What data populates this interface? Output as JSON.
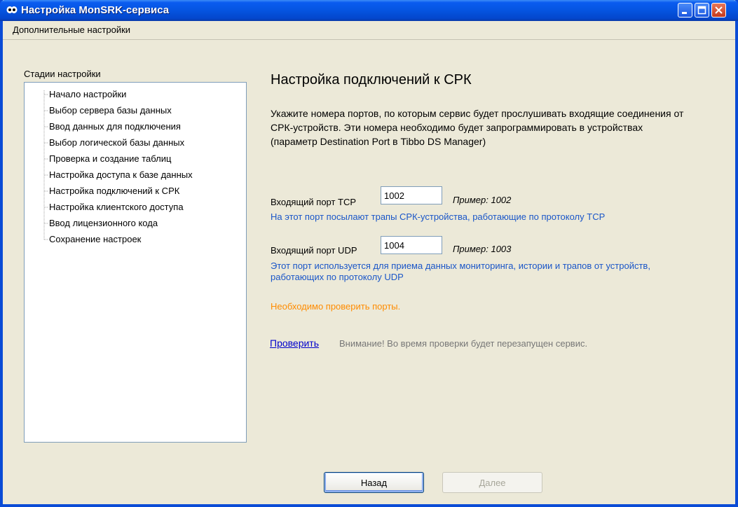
{
  "window": {
    "title": "Настройка MonSRK-сервиса",
    "icon": "app-logo-icon"
  },
  "menubar": {
    "items": [
      "Дополнительные настройки"
    ]
  },
  "sidebar": {
    "label": "Стадии настройки",
    "items": [
      "Начало настройки",
      "Выбор сервера базы данных",
      "Ввод данных для подключения",
      "Выбор логической базы данных",
      "Проверка и создание таблиц",
      "Настройка доступа к базе данных",
      "Настройка подключений к СРК",
      "Настройка клиентского доступа",
      "Ввод лицензионного кода",
      "Сохранение настроек"
    ]
  },
  "main": {
    "heading": "Настройка подключений к СРК",
    "description": "Укажите номера портов, по которым сервис будет прослушивать входящие соединения от СРК-устройств. Эти номера необходимо будет запрограммировать в устройствах (параметр Destination Port в Tibbo DS Manager)",
    "tcp": {
      "label": "Входящий порт TCP",
      "value": "1002",
      "example": "Пример: 1002",
      "hint": "На этот порт посылают трапы СРК-устройства, работающие по протоколу TCP"
    },
    "udp": {
      "label": "Входящий порт UDP",
      "value": "1004",
      "example": "Пример: 1003",
      "hint": "Этот порт используется для приема данных мониторинга, истории и трапов от устройств, работающих по протоколу UDP"
    },
    "warning": "Необходимо проверить порты.",
    "check_link": "Проверить",
    "notice": "Внимание! Во время проверки будет перезапущен сервис."
  },
  "buttons": {
    "back": "Назад",
    "next": "Далее"
  },
  "colors": {
    "title_bar": "#0554e0",
    "hint_text": "#1a56c8",
    "warning_text": "#ff8c00",
    "link": "#0000cc"
  }
}
